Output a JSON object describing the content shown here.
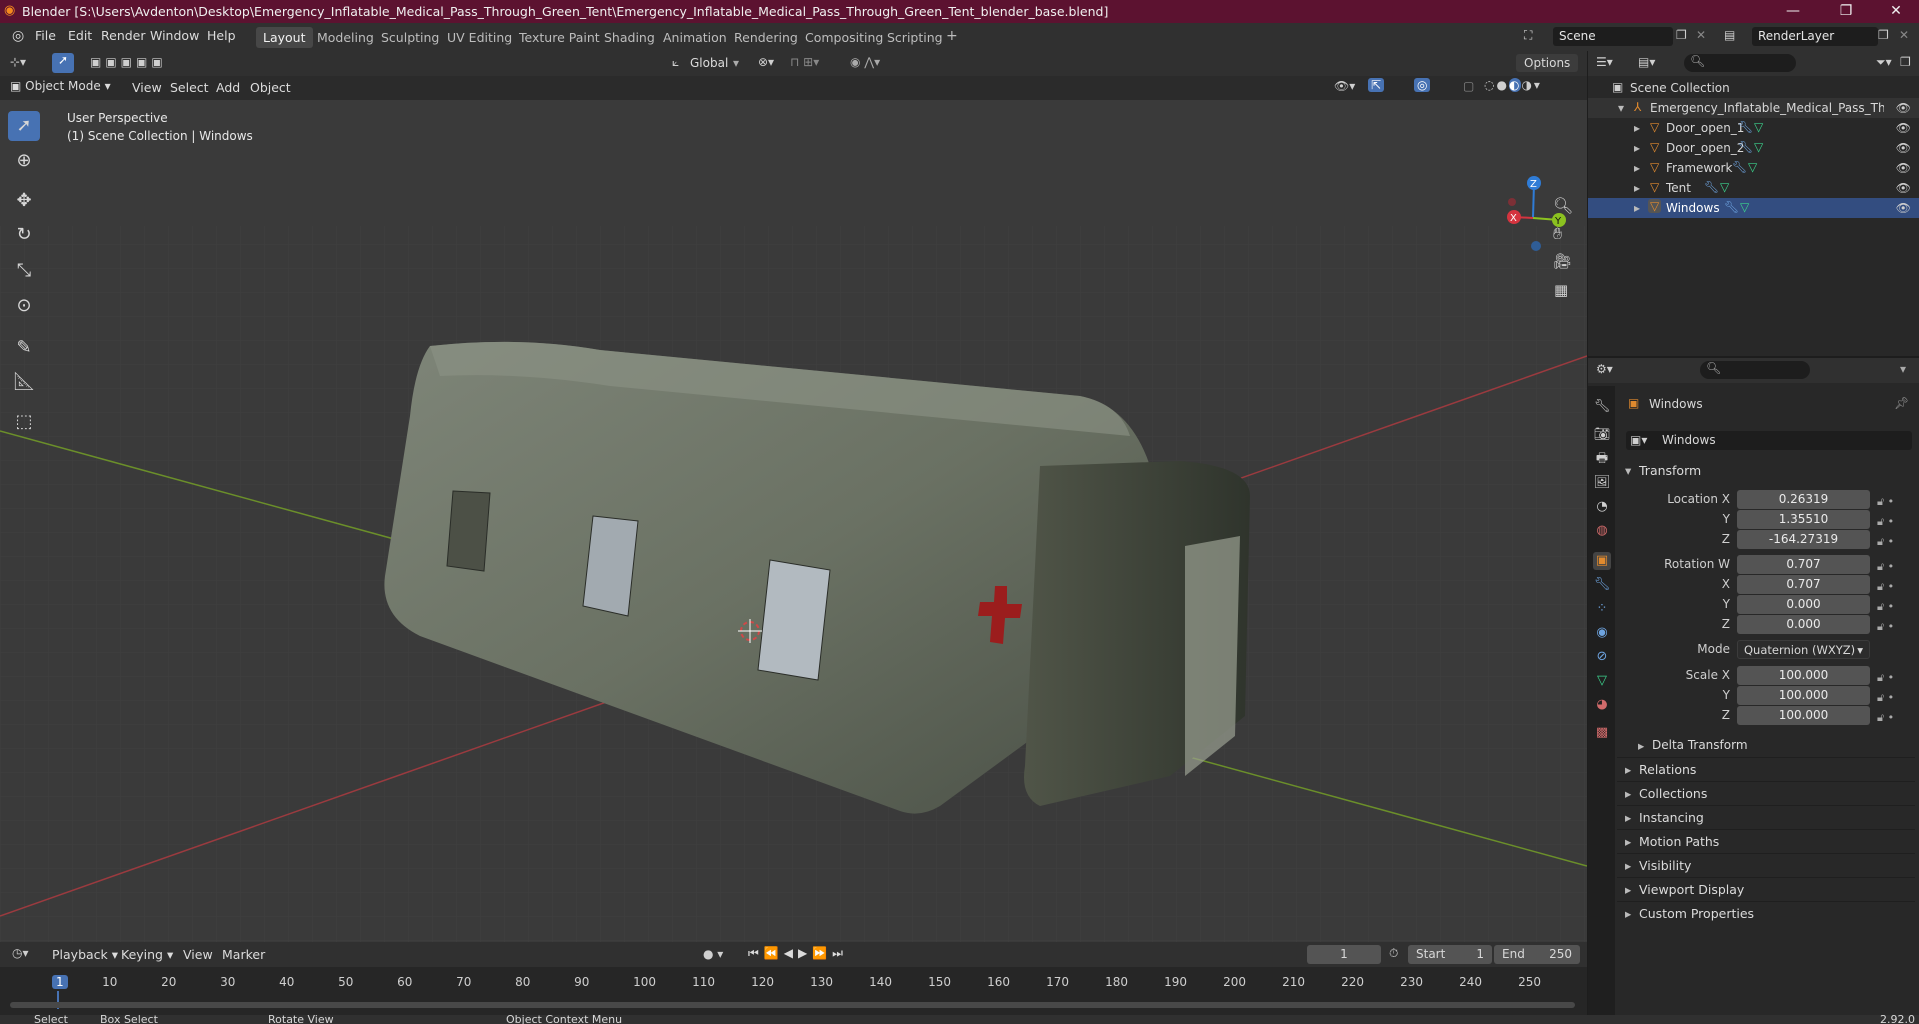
{
  "window": {
    "title": "Blender [S:\\Users\\Avdenton\\Desktop\\Emergency_Inflatable_Medical_Pass_Through_Green_Tent\\Emergency_Inflatable_Medical_Pass_Through_Green_Tent_blender_base.blend]"
  },
  "menu": [
    "File",
    "Edit",
    "Render",
    "Window",
    "Help"
  ],
  "workspaces": [
    "Layout",
    "Modeling",
    "Sculpting",
    "UV Editing",
    "Texture Paint",
    "Shading",
    "Animation",
    "Rendering",
    "Compositing",
    "Scripting"
  ],
  "scene": {
    "name": "Scene",
    "render_layer": "RenderLayer"
  },
  "viewport": {
    "mode": "Object Mode",
    "menus": [
      "View",
      "Select",
      "Add",
      "Object"
    ],
    "orientation": "Global",
    "options": "Options",
    "info_line1": "User Perspective",
    "info_line2": "(1) Scene Collection | Windows"
  },
  "outliner": {
    "root": "Scene Collection",
    "collection": "Emergency_Inflatable_Medical_Pass_Througl",
    "items": [
      "Door_open_1",
      "Door_open_2",
      "Framework",
      "Tent",
      "Windows"
    ]
  },
  "properties": {
    "object_name": "Windows",
    "data_name": "Windows",
    "transform_label": "Transform",
    "location_label": "Location X",
    "location": [
      "0.26319",
      "1.35510",
      "-164.27319"
    ],
    "rotation_label": "Rotation W",
    "rotation": [
      "0.707",
      "0.707",
      "0.000",
      "0.000"
    ],
    "mode_label": "Mode",
    "mode_value": "Quaternion (WXYZ)",
    "scale_label": "Scale X",
    "scale": [
      "100.000",
      "100.000",
      "100.000"
    ],
    "axis": [
      "X",
      "Y",
      "Z"
    ],
    "delta": "Delta Transform",
    "panels": [
      "Relations",
      "Collections",
      "Instancing",
      "Motion Paths",
      "Visibility",
      "Viewport Display",
      "Custom Properties"
    ]
  },
  "timeline": {
    "menus": [
      "Playback",
      "Keying",
      "View",
      "Marker"
    ],
    "current_frame": "1",
    "start_label": "Start",
    "start": "1",
    "end_label": "End",
    "end": "250",
    "ticks": [
      "1",
      "10",
      "20",
      "30",
      "40",
      "50",
      "60",
      "70",
      "80",
      "90",
      "100",
      "110",
      "120",
      "130",
      "140",
      "150",
      "160",
      "170",
      "180",
      "190",
      "200",
      "210",
      "220",
      "230",
      "240",
      "250"
    ]
  },
  "status": {
    "select": "Select",
    "box_select": "Box Select",
    "rotate": "Rotate View",
    "context": "Object Context Menu",
    "version": "2.92.0"
  },
  "colors": {
    "title_bg": "#5c1230",
    "accent": "#4772b3",
    "tent": "#6f7667",
    "x_axis": "#d4343f",
    "y_axis": "#8bc220",
    "z_axis": "#2f7cd6"
  }
}
